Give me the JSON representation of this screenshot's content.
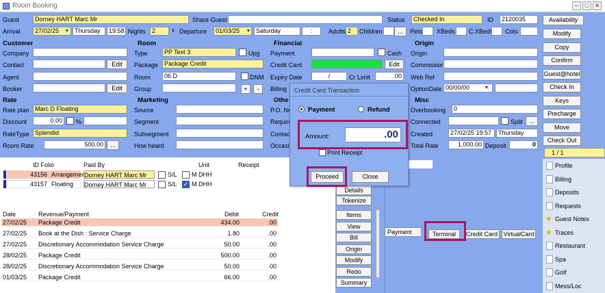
{
  "window": {
    "title": "Room Booking",
    "min": "─",
    "max": "□",
    "close": "✕"
  },
  "top": {
    "guest_lbl": "Guest",
    "guest": "Dorney HART Marc Mr",
    "share_lbl": "Share Guest",
    "share": "",
    "status_lbl": "Status",
    "status": "Checked In",
    "id_lbl": "ID",
    "id": "2120035",
    "arrival_lbl": "Arrival",
    "arrival": "27/02/25",
    "arr_day": "Thursday",
    "arr_time": "19:58",
    "nights_lbl": "Nights",
    "nights": "2",
    "departure_lbl": "Departure",
    "departure": "01/03/25",
    "dep_day": "Saturday",
    "dep_time": ":",
    "adults_lbl": "Adults",
    "adults": "2",
    "children_lbl": "Children",
    "children": "",
    "more": "...",
    "pets_lbl": "Pets",
    "xbeds_lbl": "XBeds",
    "cxbeds_lbl": "C.XBeds",
    "cots_lbl": "Cots"
  },
  "customer": {
    "title": "Customer",
    "company": "Company",
    "contact": "Contact",
    "agent": "Agent",
    "booker": "Booker",
    "edit": "Edit"
  },
  "room": {
    "title": "Room",
    "type_lbl": "Type",
    "type": "PP Test 3",
    "upg": "Upg",
    "package_lbl": "Package",
    "package": "Package Credit",
    "room_lbl": "Room",
    "room": "06 D",
    "dnm": "DNM",
    "group_lbl": "Group",
    "plus": "+",
    "minus": "-"
  },
  "financial": {
    "title": "Financial",
    "payment": "Payment",
    "cash": "Cash",
    "credit_card": "Credit Card",
    "edit": "Edit",
    "expiry": "Expiry Date",
    "slash": "/",
    "cr_limit": "Cr Limit",
    "cr_val": ".00",
    "billing": "Billing"
  },
  "origin": {
    "title": "Origin",
    "origin": "Origin",
    "commission": "Commission",
    "webref": "Web Ref",
    "optiondate": "OptionDate",
    "optionval": "00/00/00"
  },
  "rate": {
    "title": "Rate",
    "plan_lbl": "Rate plan",
    "plan": "Marc D Floating",
    "discount_lbl": "Discount",
    "discount": "0.00",
    "pct": "%",
    "ratetype_lbl": "RateType",
    "ratetype": "Splendid",
    "roomrate_lbl": "Room Rate",
    "roomrate": "500.00"
  },
  "marketing": {
    "title": "Marketing",
    "source": "Source",
    "segment": "Segment",
    "subsegment": "Subsegment",
    "howheard": "How heard"
  },
  "other": {
    "title": "Othe",
    "po": "P.O. Nr",
    "require": "Require",
    "contact": "Contac",
    "occasion": "Occasio"
  },
  "misc": {
    "title": "Misc",
    "overbooking_lbl": "Overbooking",
    "overbooking": "0",
    "connected_lbl": "Connected",
    "split": "Split",
    "created_lbl": "Created",
    "created": "27/02/25 19:57",
    "created_day": "Thursday",
    "total_lbl": "Total Rate",
    "total": "1,000.00",
    "deposit_lbl": "Deposit",
    "deposit": "0"
  },
  "sidebuttons": [
    "Availability",
    "Modify",
    "Copy",
    "Confirm",
    "Guest@hotel",
    "Check In",
    "Keys",
    "Precharge",
    "Move",
    "Check Out"
  ],
  "pager": "1 / 1",
  "folios": {
    "headers": [
      "ID Folio",
      "Paid By",
      "Unit",
      "Receipt"
    ],
    "rows": [
      {
        "id": "43156",
        "name": "Arrangement",
        "paid": "Dorney HART Marc Mr",
        "sl": "S/L",
        "m": "M",
        "unit": "DHH"
      },
      {
        "id": "43157",
        "name": "Floating",
        "paid": "Dorney HART Marc Mr",
        "sl": "S/L",
        "m": "M",
        "unit": "DHH"
      }
    ]
  },
  "folio_buttons": [
    "Details",
    "Tokenize"
  ],
  "postings": {
    "headers": [
      "Date",
      "Revenue/Payment",
      "Debit",
      "Credit"
    ],
    "rows": [
      {
        "date": "27/02/25",
        "desc": "Package Credit",
        "debit": "434.00",
        "credit": ".00"
      },
      {
        "date": "27/02/25",
        "desc": "Book at the Dish : Service Charge",
        "debit": "1.80",
        "credit": ".00"
      },
      {
        "date": "27/02/25",
        "desc": "Discretionary Accommodation Service Charge",
        "debit": "50.00",
        "credit": ".00"
      },
      {
        "date": "28/02/25",
        "desc": "Package Credit",
        "debit": "500.00",
        "credit": ".00"
      },
      {
        "date": "28/02/25",
        "desc": "Discretionary Accommodation Service Charge",
        "debit": "50.00",
        "credit": ".00"
      },
      {
        "date": "01/03/25",
        "desc": "Package Credit",
        "debit": "66.00",
        "credit": ".00"
      }
    ]
  },
  "posting_buttons": [
    "Items",
    "View",
    "Bill",
    "Origin",
    "Modify",
    "Redo",
    "Summary"
  ],
  "payment_tabs": {
    "payment": "Payment",
    "terminal": "Terminal",
    "credit_card": "Credit Card",
    "virtual": "VirtualCard"
  },
  "tabs": [
    "Profile",
    "Billing",
    "Deposits",
    "Requests",
    "Guest Notes",
    "Traces",
    "Restaurant",
    "Spa",
    "Golf",
    "Mess/Loc"
  ],
  "dialog": {
    "title": "Credit Card Transaction",
    "payment": "Payment",
    "refund": "Refund",
    "amount_lbl": "Amount:",
    "amount": ".00",
    "print": "Print Receipt",
    "proceed": "Proceed",
    "close": "Close"
  },
  "colors": {
    "panel": "#87a8ec",
    "highlight": "#a3185e",
    "yellow": "#fbf29a",
    "green": "#19e03a",
    "pink": "#f6c6b3"
  }
}
